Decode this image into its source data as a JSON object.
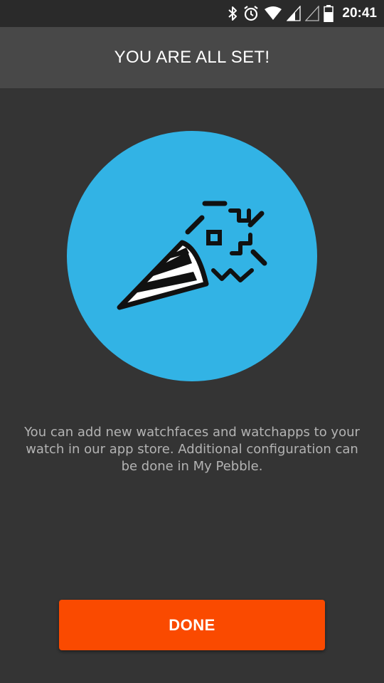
{
  "status_bar": {
    "time": "20:41",
    "icons": [
      "bluetooth-icon",
      "alarm-icon",
      "wifi-icon",
      "signal-icon",
      "signal-empty-icon",
      "battery-icon"
    ]
  },
  "header": {
    "title": "YOU ARE ALL SET!"
  },
  "hero": {
    "illustration": "party-popper-icon",
    "circle_color": "#32b3e5"
  },
  "message": {
    "text": "You can add new watchfaces and watchapps to your watch in our app store. Additional configuration can be done in My Pebble."
  },
  "done_button": {
    "label": "DONE",
    "color": "#fa4a00"
  }
}
